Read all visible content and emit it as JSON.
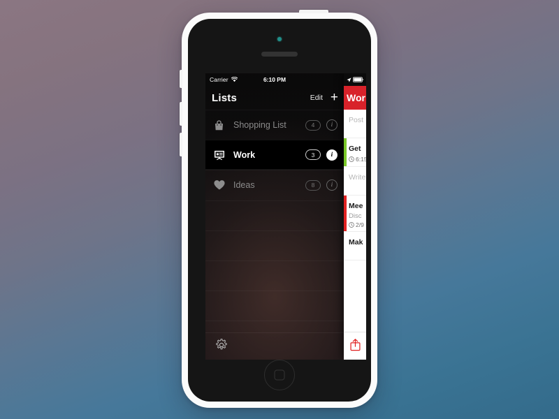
{
  "device": {
    "name": "iphone-5c-white",
    "body_color": "#fbfbfb",
    "bezel_color": "#151515"
  },
  "background": {
    "gradient_from": "#8b7682",
    "gradient_to": "#336b8b"
  },
  "status_bar": {
    "carrier": "Carrier",
    "wifi_icon": "wifi-icon",
    "time": "6:10 PM",
    "location_icon": "location-arrow-icon",
    "battery_icon": "battery-full-icon"
  },
  "sidebar": {
    "title": "Lists",
    "edit_label": "Edit",
    "add_label": "+",
    "settings_icon": "gear-icon",
    "items": [
      {
        "label": "Shopping List",
        "icon": "shopping-bag-icon",
        "count": "4",
        "info_label": "i",
        "selected": false
      },
      {
        "label": "Work",
        "icon": "presentation-board-icon",
        "count": "3",
        "info_label": "i",
        "selected": true
      },
      {
        "label": "Ideas",
        "icon": "heart-icon",
        "count": "8",
        "info_label": "i",
        "selected": false
      }
    ]
  },
  "task_panel": {
    "header_title": "Wor",
    "header_color": "#d8222a",
    "share_icon": "share-export-icon",
    "tasks": [
      {
        "title": "Post",
        "muted": true,
        "subtitle": "",
        "meta": "",
        "accent": "none"
      },
      {
        "title": "Get",
        "muted": false,
        "subtitle": "",
        "meta": "6:15",
        "accent": "#7ac829"
      },
      {
        "title": "Write",
        "muted": true,
        "subtitle": "",
        "meta": "",
        "accent": "none"
      },
      {
        "title": "Mee",
        "muted": false,
        "subtitle": "Disc",
        "meta": "2/9",
        "accent": "#e02121"
      },
      {
        "title": "Mak",
        "muted": false,
        "subtitle": "",
        "meta": "",
        "accent": "none"
      }
    ]
  }
}
